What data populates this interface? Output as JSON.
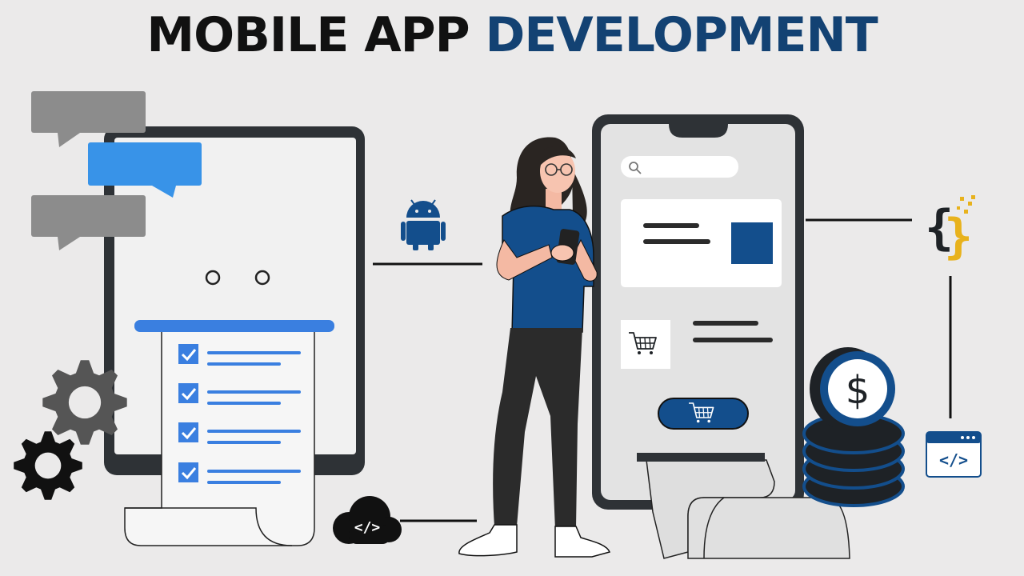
{
  "title": {
    "word1": "MOBILE APP",
    "word2": "DEVELOPMENT"
  },
  "colors": {
    "background": "#ebeaea",
    "title_dark": "#111111",
    "title_blue": "#134273",
    "navy": "#134e8c",
    "bright_blue": "#3a7fe0",
    "chat_blue": "#3893e8",
    "gray_bubble": "#8c8c8c",
    "device_frame": "#2e3236",
    "accent_gold": "#e8b21c"
  },
  "icons": [
    "chat-bubble-icon",
    "gear-icon",
    "checkbox-icon",
    "android-icon",
    "search-icon",
    "shopping-cart-icon",
    "dollar-coin-icon",
    "curly-braces-code-icon",
    "browser-code-icon",
    "cloud-code-icon"
  ],
  "cloud_icon_text": "</>",
  "browser_icon_text": "</>"
}
